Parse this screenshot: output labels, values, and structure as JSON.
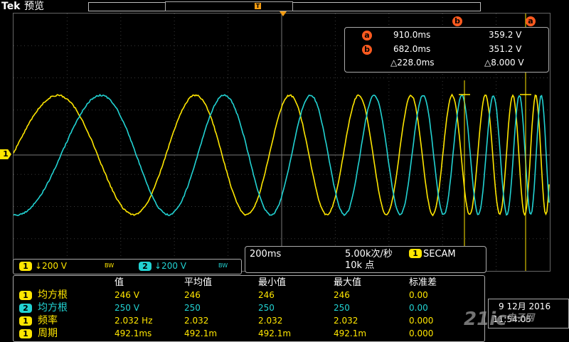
{
  "topbar": {
    "brand": "Tek",
    "mode": "预览",
    "trigger_pos_icon": "T"
  },
  "channel_marker": {
    "label": "1"
  },
  "cursors": {
    "header_a": "a",
    "header_b": "b",
    "a": {
      "badge": "a",
      "time": "910.0ms",
      "volt": "359.2 V"
    },
    "b": {
      "badge": "b",
      "time": "682.0ms",
      "volt": "351.2 V"
    },
    "delta": {
      "time": "△228.0ms",
      "volt": "△8.000 V"
    }
  },
  "horizontal": {
    "scale": "200ms",
    "rate": "5.00k次/秒",
    "record": "10k 点",
    "trigger_ch": "1",
    "trigger_mode": "SECAM"
  },
  "channels": [
    {
      "num": "1",
      "scale": "↓200 V",
      "bw": "BW",
      "color": "#ffe600"
    },
    {
      "num": "2",
      "scale": "↓200 V",
      "bw": "BW",
      "color": "#22d3d3"
    }
  ],
  "measurements": {
    "headers": [
      "值",
      "平均值",
      "最小值",
      "最大值",
      "标准差"
    ],
    "rows": [
      {
        "ch": "1",
        "name": "均方根",
        "color": "#ffe600",
        "vals": [
          "246 V",
          "246",
          "246",
          "246",
          "0.00"
        ]
      },
      {
        "ch": "2",
        "name": "均方根",
        "color": "#22d3d3",
        "vals": [
          "250 V",
          "250",
          "250",
          "250",
          "0.00"
        ]
      },
      {
        "ch": "1",
        "name": "频率",
        "color": "#ffe600",
        "vals": [
          "2.032 Hz",
          "2.032",
          "2.032",
          "2.032",
          "0.000"
        ]
      },
      {
        "ch": "1",
        "name": "周期",
        "color": "#ffe600",
        "vals": [
          "492.1ms",
          "492.1m",
          "492.1m",
          "492.1m",
          "0.000"
        ]
      }
    ]
  },
  "datetime": {
    "date": "9 12月 2016",
    "time": "11:54:05"
  },
  "watermark": {
    "text": "21ic",
    "sub": "电子网"
  },
  "colors": {
    "ch1": "#ffe600",
    "ch2": "#22d3d3",
    "cursor": "#ff5a1f",
    "grid": "#555555"
  }
}
